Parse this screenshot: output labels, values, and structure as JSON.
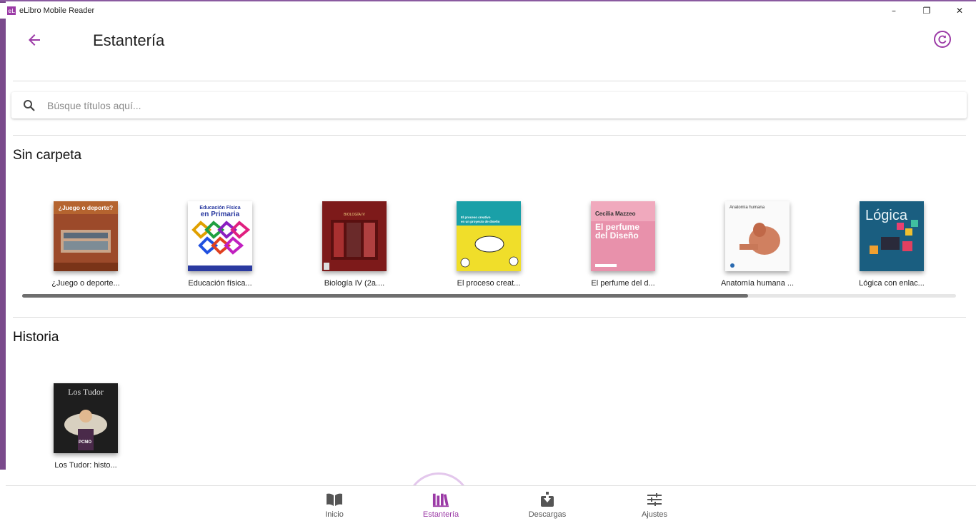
{
  "window": {
    "title": "eLibro Mobile Reader",
    "icon_text": "eL",
    "controls": [
      "–",
      "❐",
      "✕"
    ]
  },
  "appbar": {
    "title": "Estantería",
    "back_icon": "arrow-left-icon",
    "refresh_icon": "refresh-icon"
  },
  "search": {
    "placeholder": "Búsque títulos aquí..."
  },
  "sections": [
    {
      "title": "Sin carpeta",
      "books": [
        {
          "label": "¿Juego o deporte...",
          "cover_title": "¿Juego o deporte?"
        },
        {
          "label": "Educación física...",
          "cover_title": "Educación Física en Primaria"
        },
        {
          "label": "Biología IV (2a....",
          "cover_title": "BIOLOGÍA IV"
        },
        {
          "label": "El proceso creat...",
          "cover_title": "El proceso creativo en un proyecto de diseño"
        },
        {
          "label": "El perfume del d...",
          "cover_title": "El perfume del Diseño",
          "cover_author": "Cecilia Mazzeo"
        },
        {
          "label": "Anatomía humana ...",
          "cover_title": "Anatomía humana"
        },
        {
          "label": "Lógica con enlac...",
          "cover_title": "Lógica"
        }
      ]
    },
    {
      "title": "Historia",
      "books": [
        {
          "label": "Los Tudor: histo...",
          "cover_title": "Los Tudor"
        }
      ]
    }
  ],
  "bottom_nav": [
    {
      "label": "Inicio",
      "icon": "book-open-icon",
      "active": false
    },
    {
      "label": "Estantería",
      "icon": "bookshelf-icon",
      "active": true
    },
    {
      "label": "Descargas",
      "icon": "download-icon",
      "active": false
    },
    {
      "label": "Ajustes",
      "icon": "sliders-icon",
      "active": false
    }
  ],
  "colors": {
    "accent": "#9b3aa6",
    "edge": "#7a4a8c"
  }
}
